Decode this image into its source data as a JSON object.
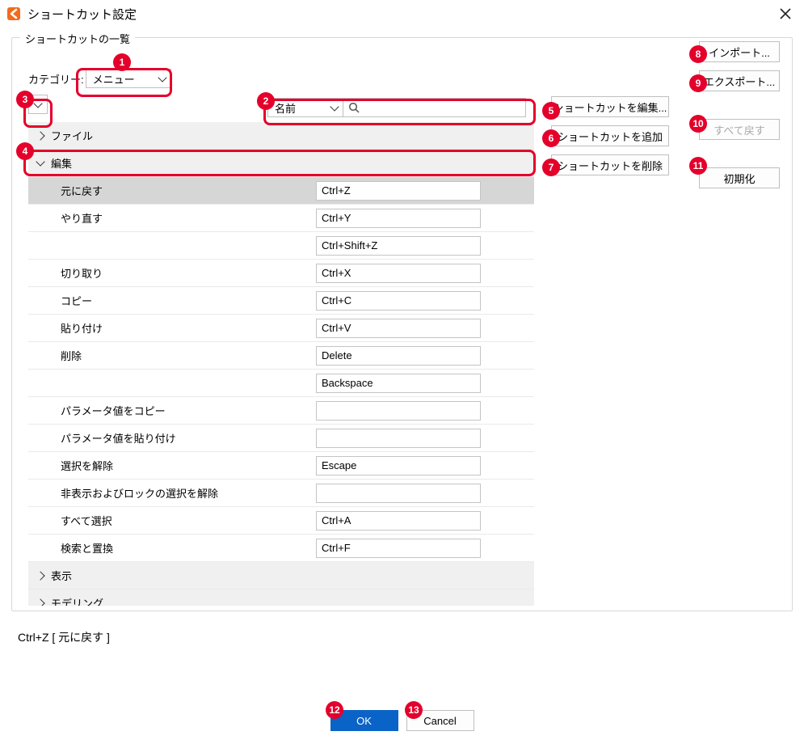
{
  "window": {
    "title": "ショートカット設定"
  },
  "group_legend": "ショートカットの一覧",
  "category": {
    "label": "カテゴリー:",
    "selected": "メニュー"
  },
  "search": {
    "type_selected": "名前",
    "placeholder": ""
  },
  "right_buttons": {
    "edit": "ショートカットを編集...",
    "add": "ショートカットを追加",
    "delete": "ショートカットを削除",
    "import": "インポート...",
    "export": "エクスポート...",
    "revert_all": "すべて戻す",
    "reset": "初期化"
  },
  "tree": {
    "groups": [
      {
        "label": "ファイル",
        "expanded": false
      },
      {
        "label": "編集",
        "expanded": true,
        "selected_group": true,
        "items": [
          {
            "name": "元に戻す",
            "shortcuts": [
              "Ctrl+Z"
            ],
            "selected": true
          },
          {
            "name": "やり直す",
            "shortcuts": [
              "Ctrl+Y",
              "Ctrl+Shift+Z"
            ]
          },
          {
            "name": "切り取り",
            "shortcuts": [
              "Ctrl+X"
            ]
          },
          {
            "name": "コピー",
            "shortcuts": [
              "Ctrl+C"
            ]
          },
          {
            "name": "貼り付け",
            "shortcuts": [
              "Ctrl+V"
            ]
          },
          {
            "name": "削除",
            "shortcuts": [
              "Delete",
              "Backspace"
            ]
          },
          {
            "name": "パラメータ値をコピー",
            "shortcuts": [
              ""
            ]
          },
          {
            "name": "パラメータ値を貼り付け",
            "shortcuts": [
              ""
            ]
          },
          {
            "name": "選択を解除",
            "shortcuts": [
              "Escape"
            ]
          },
          {
            "name": "非表示およびロックの選択を解除",
            "shortcuts": [
              ""
            ]
          },
          {
            "name": "すべて選択",
            "shortcuts": [
              "Ctrl+A"
            ]
          },
          {
            "name": "検索と置換",
            "shortcuts": [
              "Ctrl+F"
            ]
          }
        ]
      },
      {
        "label": "表示",
        "expanded": false
      },
      {
        "label": "モデリング",
        "expanded": false
      }
    ]
  },
  "status": "Ctrl+Z   [ 元に戻す ]",
  "buttons": {
    "ok": "OK",
    "cancel": "Cancel"
  },
  "annotations": [
    "1",
    "2",
    "3",
    "4",
    "5",
    "6",
    "7",
    "8",
    "9",
    "10",
    "11",
    "12",
    "13"
  ]
}
